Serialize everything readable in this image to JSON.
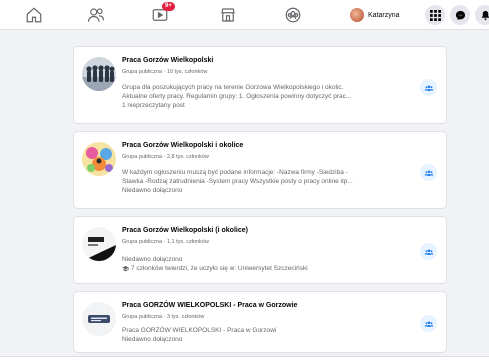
{
  "topbar": {
    "notifications_badge": "9+",
    "user_name": "Katarzyna"
  },
  "groups": [
    {
      "title": "Praca Gorzów Wielkopolski",
      "meta": "Grupa publiczna · 10 tys. członków",
      "lines": [
        "Grupa dla poszukujących pracy na terenie Gorzowa Wielkopolskiego i okolic.",
        "Aktualne oferty pracy. Regulamin grupy: 1. Ogłoszenia powinny dotyczyć prac...",
        "1 nieprzeczytany post"
      ]
    },
    {
      "title": "Praca Gorzów Wielkopolski i okolice",
      "meta": "Grupa publiczna · 2,8 tys. członków",
      "lines": [
        "W każdym ogłoszeniu muszą być podane informacje: -Nazwa firmy -Siedziba -",
        "Stawka -Rodzaj zatrudnienia -System pracy Wszystkie posty o pracy online itp...",
        "Niedawno dołączono"
      ]
    },
    {
      "title": "Praca Gorzów Wielkopolski (i okolice)",
      "meta": "Grupa publiczna · 1,1 tys. członków",
      "lines": [
        "Niedawno dołączono",
        "7 członków twierdzi, że uczyło się w: Uniwersytet Szczeciński"
      ]
    },
    {
      "title": "Praca GORZÓW WIELKOPOLSKI - Praca w Gorzowie",
      "meta": "Grupa publiczna · 3 tys. członków",
      "lines": [
        "Praca GORZÓW WIELKOPOLSKI - Praca w Gorzowi",
        "Niedawno dołączono"
      ]
    }
  ],
  "colors": {
    "accent": "#1877f2",
    "badge": "#e41e3f",
    "muted_text": "#65676b",
    "page_bg": "#f0f2f5"
  },
  "icons": {
    "home": "home-icon",
    "friends": "friends-icon",
    "watch": "video-icon",
    "marketplace": "marketplace-icon",
    "groups": "groups-icon",
    "menu": "grid-menu-icon",
    "messenger": "messenger-icon",
    "notifications": "bell-icon",
    "join": "group-join-icon"
  }
}
